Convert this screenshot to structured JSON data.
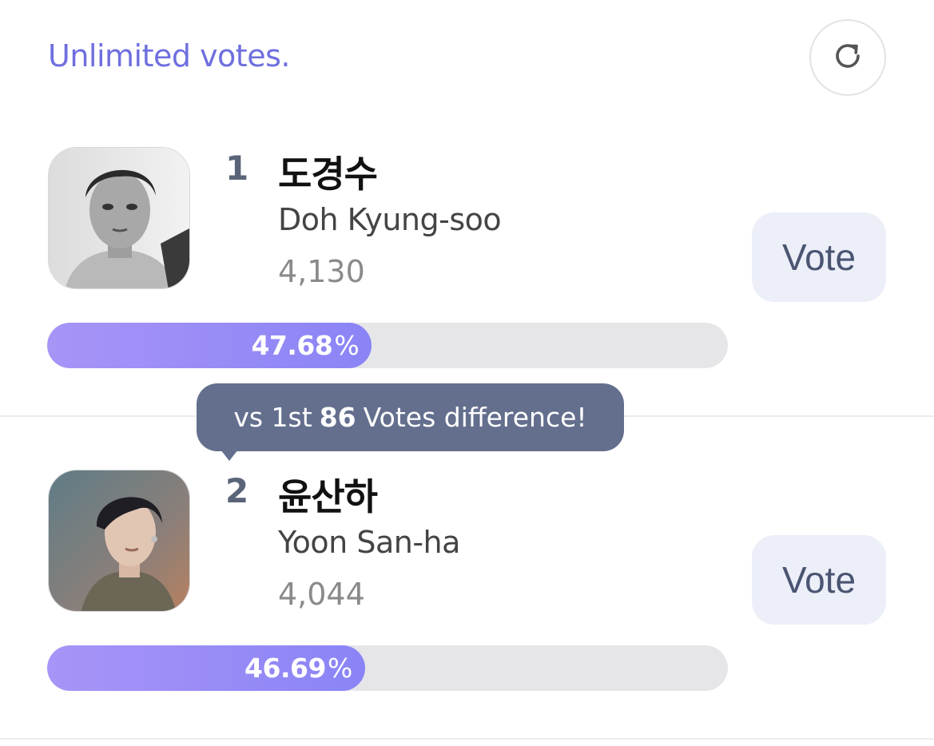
{
  "header": {
    "note": "Unlimited votes.",
    "refresh_icon": "refresh-icon"
  },
  "colors": {
    "accent_text": "#6f6fe0",
    "bar_fill_start": "#a894f7",
    "bar_fill_end": "#8a84f6",
    "tooltip_bg": "#646f8e",
    "vote_button_bg": "#eceff8"
  },
  "candidates": [
    {
      "rank": "1",
      "name_ko": "도경수",
      "name_en": "Doh Kyung-soo",
      "votes": "4,130",
      "percent_value": "47.68",
      "percent_unit": "%",
      "share": 47.68,
      "vote_label": "Vote"
    },
    {
      "rank": "2",
      "name_ko": "윤산하",
      "name_en": "Yoon San-ha",
      "votes": "4,044",
      "percent_value": "46.69",
      "percent_unit": "%",
      "share": 46.69,
      "vote_label": "Vote"
    }
  ],
  "tooltip": {
    "prefix": "vs 1st",
    "diff": "86",
    "suffix": "Votes difference!"
  }
}
